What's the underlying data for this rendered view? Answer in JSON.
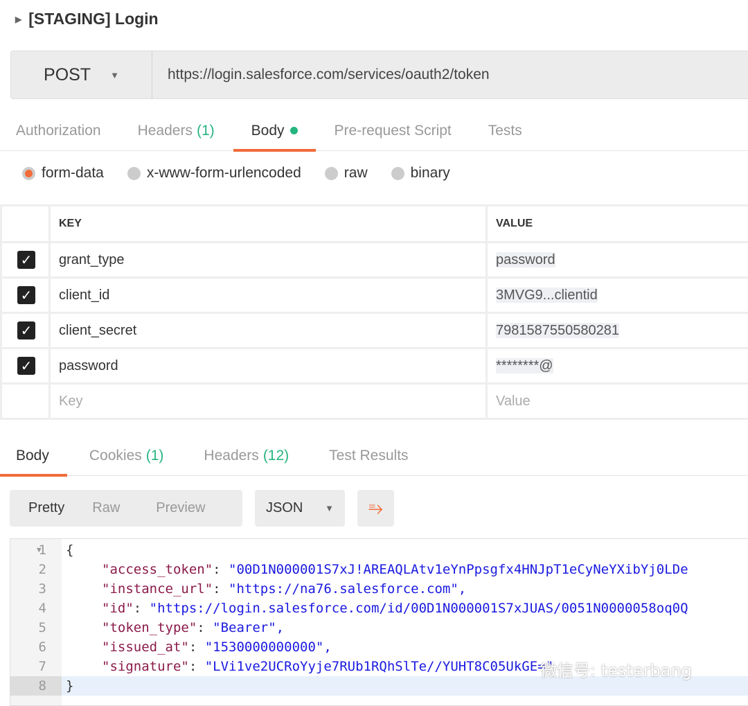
{
  "request": {
    "title": "[STAGING] Login",
    "method": "POST",
    "url": "https://login.salesforce.com/services/oauth2/token"
  },
  "tabs": [
    {
      "label": "Authorization"
    },
    {
      "label": "Headers",
      "count": "(1)"
    },
    {
      "label": "Body"
    },
    {
      "label": "Pre-request Script"
    },
    {
      "label": "Tests"
    }
  ],
  "body_types": [
    {
      "label": "form-data",
      "selected": true
    },
    {
      "label": "x-www-form-urlencoded"
    },
    {
      "label": "raw"
    },
    {
      "label": "binary"
    }
  ],
  "form": {
    "headers": [
      "KEY",
      "VALUE"
    ],
    "rows": [
      {
        "key": "grant_type",
        "value": "password",
        "checked": true
      },
      {
        "key": "client_id",
        "value": "3MVG9...clientid",
        "checked": true
      },
      {
        "key": "client_secret",
        "value": "7981587550580281",
        "checked": true
      },
      {
        "key": "password",
        "value": "********@",
        "checked": true
      }
    ],
    "key_placeholder": "Key",
    "value_placeholder": "Value"
  },
  "response_tabs": [
    {
      "label": "Body"
    },
    {
      "label": "Cookies",
      "count": "(1)"
    },
    {
      "label": "Headers",
      "count": "(12)"
    },
    {
      "label": "Test Results"
    }
  ],
  "view_modes": [
    "Pretty",
    "Raw",
    "Preview"
  ],
  "format": "JSON",
  "code": [
    {
      "n": "1",
      "text": "{"
    },
    {
      "n": "2",
      "key": "\"access_token\"",
      "val": "\"00D1N000001S7xJ!AREAQLAtv1eYnPpsgfx4HNJpT1eCyNeYXibYj0LDe"
    },
    {
      "n": "3",
      "key": "\"instance_url\"",
      "val": "\"https://na76.salesforce.com\","
    },
    {
      "n": "4",
      "key": "\"id\"",
      "val": "\"https://login.salesforce.com/id/00D1N000001S7xJUAS/0051N0000058oq0Q"
    },
    {
      "n": "5",
      "key": "\"token_type\"",
      "val": "\"Bearer\","
    },
    {
      "n": "6",
      "key": "\"issued_at\"",
      "val": "\"1530000000000\","
    },
    {
      "n": "7",
      "key": "\"signature\"",
      "val": "\"LVi1ve2UCRoYyje7RUb1RQhSlTe//YUHT8C05UkGE=\""
    },
    {
      "n": "8",
      "text": "}"
    }
  ],
  "watermark": "微信号: testerbang",
  "colors": {
    "accent": "#f26b3a",
    "count_green": "#26b47f",
    "json_key": "#8b1a4a",
    "json_string": "#1a1ae0"
  }
}
